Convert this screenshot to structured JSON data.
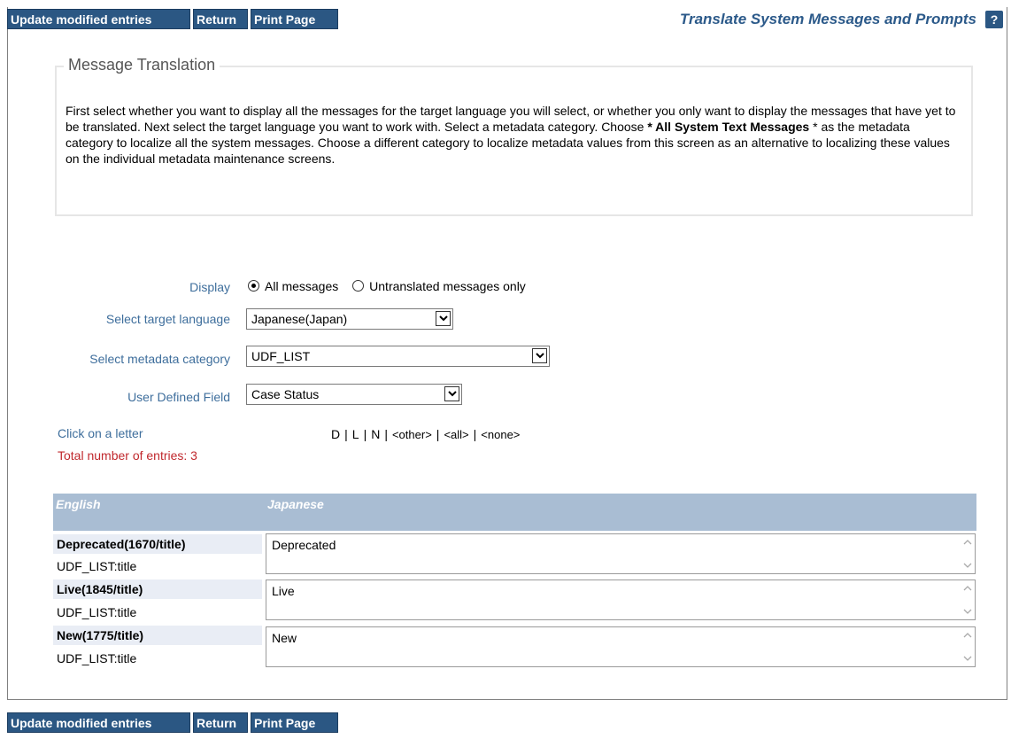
{
  "toolbar": {
    "update_label": "Update modified entries",
    "return_label": "Return",
    "print_label": "Print Page"
  },
  "header": {
    "title": "Translate System Messages and Prompts",
    "help_label": "?"
  },
  "intro": {
    "legend": "Message Translation",
    "text_part1": "First select whether you want to display all the messages for the target language you will select, or whether you only want to display the messages that have yet to be translated. Next select the target language you want to work with. Select a metadata category. Choose ",
    "text_bold": "* All System Text Messages",
    "text_part2": " * as the metadata category to localize all the system messages. Choose a different category to localize metadata values from this screen as an alternative to localizing these values on the individual metadata maintenance screens."
  },
  "form": {
    "display_label": "Display",
    "display_options": [
      "All messages",
      "Untranslated messages only"
    ],
    "display_selected": "All messages",
    "language_label": "Select target language",
    "language_value": "Japanese(Japan)",
    "category_label": "Select metadata category",
    "category_value": "UDF_LIST",
    "udf_label": "User Defined Field",
    "udf_value": "Case Status",
    "click_letter_label": "Click on a letter",
    "letters": [
      "D",
      "L",
      "N"
    ],
    "other_label": "<other>",
    "all_label": "<all>",
    "none_label": "<none>",
    "total_label": "Total number of entries: 3"
  },
  "table": {
    "col_english": "English",
    "col_japanese": "Japanese",
    "rows": [
      {
        "name": "Deprecated(1670/title)",
        "sub": "UDF_LIST:title",
        "value": "Deprecated"
      },
      {
        "name": "Live(1845/title)",
        "sub": "UDF_LIST:title",
        "value": "Live"
      },
      {
        "name": "New(1775/title)",
        "sub": "UDF_LIST:title",
        "value": "New"
      }
    ]
  },
  "colors": {
    "button_bg": "#2b5783",
    "title": "#2c5a8a",
    "label": "#3e6e9c",
    "total": "#c0282d",
    "table_header": "#a9bdd3"
  },
  "icons": {
    "dropdown": "chevron-down-icon",
    "help": "question-icon",
    "scroll_up": "scroll-up-icon",
    "scroll_down": "scroll-down-icon"
  }
}
